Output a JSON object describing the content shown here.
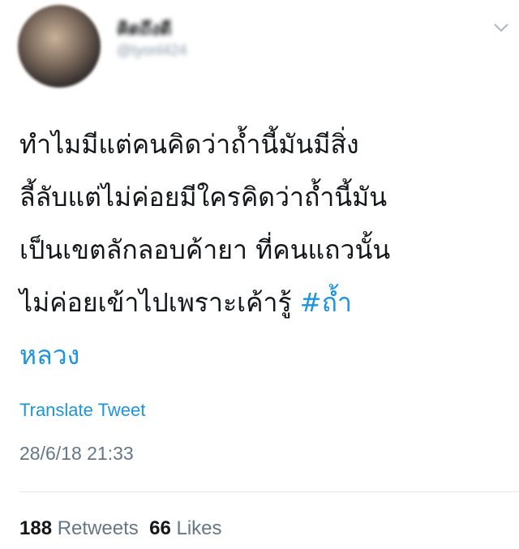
{
  "user": {
    "display_name": "คิดถึงดี",
    "handle": "@tyonl424"
  },
  "tweet": {
    "lines": [
      "ทำไมมีแต่คนคิดว่าถ้ำนี้มันมีสิ่ง",
      "ลี้ลับแต่ไม่ค่อยมีใครคิดว่าถ้ำนี้มัน",
      "เป็นเขตลักลอบค้ายา ที่คนแถวนั้น",
      "ไม่ค่อยเข้าไปเพราะเค้ารู้ "
    ],
    "hashtag_part1": "#ถ้ำ",
    "hashtag_part2": "หลวง"
  },
  "translate_label": "Translate Tweet",
  "timestamp": "28/6/18 21:33",
  "stats": {
    "retweets_count": "188",
    "retweets_label": "Retweets",
    "likes_count": "66",
    "likes_label": "Likes"
  },
  "icons": {
    "menu": "chevron-down-icon"
  },
  "colors": {
    "link": "#1b95e0",
    "text": "#14171a",
    "muted": "#657786"
  }
}
